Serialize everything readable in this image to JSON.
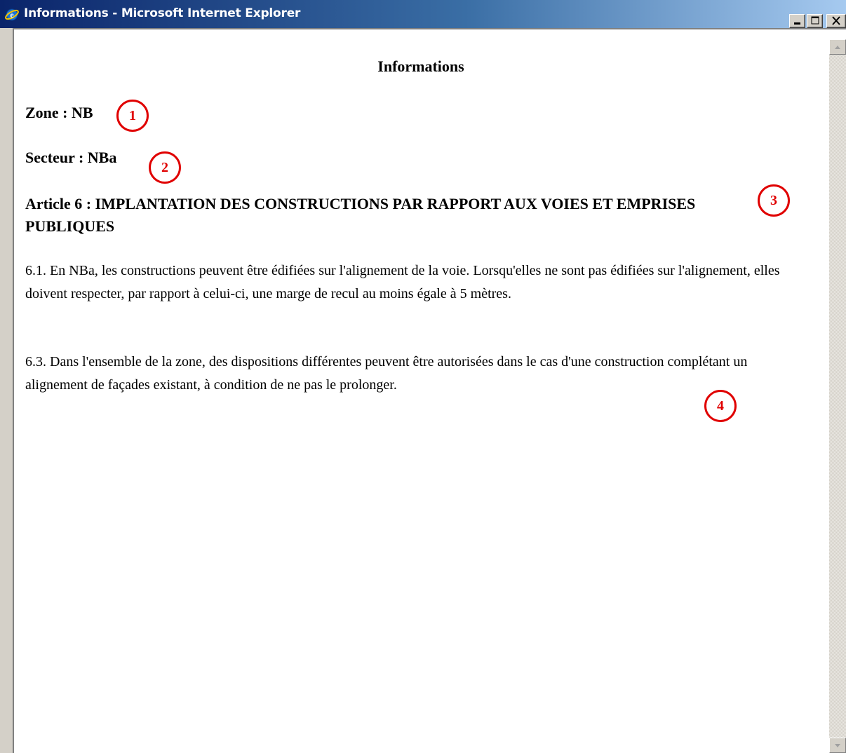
{
  "window": {
    "title": "Informations - Microsoft Internet Explorer",
    "icon": "internet-explorer-icon",
    "controls": {
      "minimize_icon": "minimize-icon",
      "maximize_icon": "maximize-icon",
      "close_icon": "close-icon"
    },
    "titlebar_colors": [
      "#0a246a",
      "#3a6ea5",
      "#a6caf0"
    ]
  },
  "page": {
    "title": "Informations",
    "zone": {
      "label": "Zone : NB"
    },
    "secteur": {
      "label": "Secteur : NBa"
    },
    "article": {
      "heading": "Article 6 : IMPLANTATION DES CONSTRUCTIONS PAR RAPPORT AUX VOIES ET EMPRISES PUBLIQUES"
    },
    "paragraphs": [
      "6.1. En NBa, les constructions peuvent être édifiées sur l'alignement de la voie. Lorsqu'elles ne sont pas édifiées sur l'alignement, elles doivent respecter, par rapport à celui-ci, une marge de recul au moins égale à 5 mètres.",
      "6.3. Dans l'ensemble de la zone, des dispositions différentes peuvent être autorisées dans le cas d'une construction complétant un alignement de façades existant, à condition de ne pas le prolonger."
    ]
  },
  "markers": [
    {
      "label": "1"
    },
    {
      "label": "2"
    },
    {
      "label": "3"
    },
    {
      "label": "4"
    }
  ],
  "marker_color": "#e00000",
  "scrollbar": {
    "up_icon": "scroll-up-arrow-icon",
    "down_icon": "scroll-down-arrow-icon"
  }
}
